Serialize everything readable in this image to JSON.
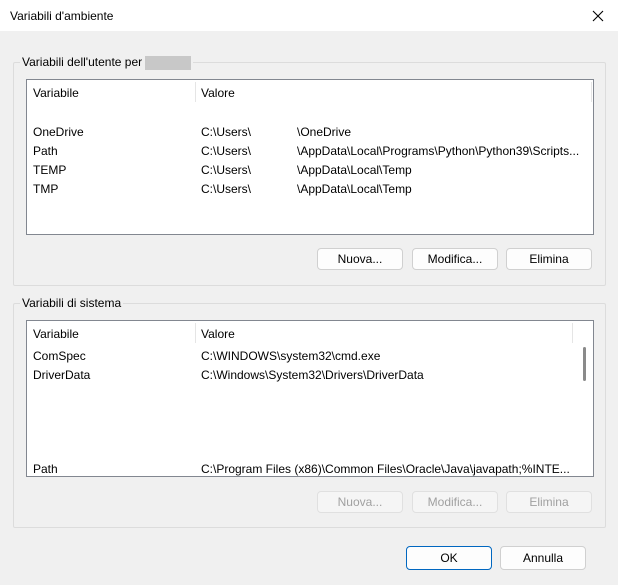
{
  "window": {
    "title": "Variabili d'ambiente"
  },
  "user_group": {
    "label": "Variabili dell'utente per",
    "columns": [
      "Variabile",
      "Valore"
    ],
    "rows": [
      {
        "name": "OneDrive",
        "value": "C:\\Users\\",
        "value2": "\\OneDrive"
      },
      {
        "name": "Path",
        "value": "C:\\Users\\",
        "value2": "\\AppData\\Local\\Programs\\Python\\Python39\\Scripts..."
      },
      {
        "name": "TEMP",
        "value": "C:\\Users\\",
        "value2": "\\AppData\\Local\\Temp"
      },
      {
        "name": "TMP",
        "value": "C:\\Users\\",
        "value2": "\\AppData\\Local\\Temp"
      }
    ],
    "buttons": {
      "new": "Nuova...",
      "edit": "Modifica...",
      "delete": "Elimina"
    }
  },
  "system_group": {
    "label": "Variabili di sistema",
    "columns": [
      "Variabile",
      "Valore"
    ],
    "rows": [
      {
        "name": "ComSpec",
        "value": "C:\\WINDOWS\\system32\\cmd.exe"
      },
      {
        "name": "DriverData",
        "value": "C:\\Windows\\System32\\Drivers\\DriverData"
      },
      {
        "name": "Path",
        "value": "C:\\Program Files (x86)\\Common Files\\Oracle\\Java\\javapath;%INTE..."
      }
    ],
    "buttons": {
      "new": "Nuova...",
      "edit": "Modifica...",
      "delete": "Elimina"
    }
  },
  "footer": {
    "ok": "OK",
    "cancel": "Annulla"
  }
}
